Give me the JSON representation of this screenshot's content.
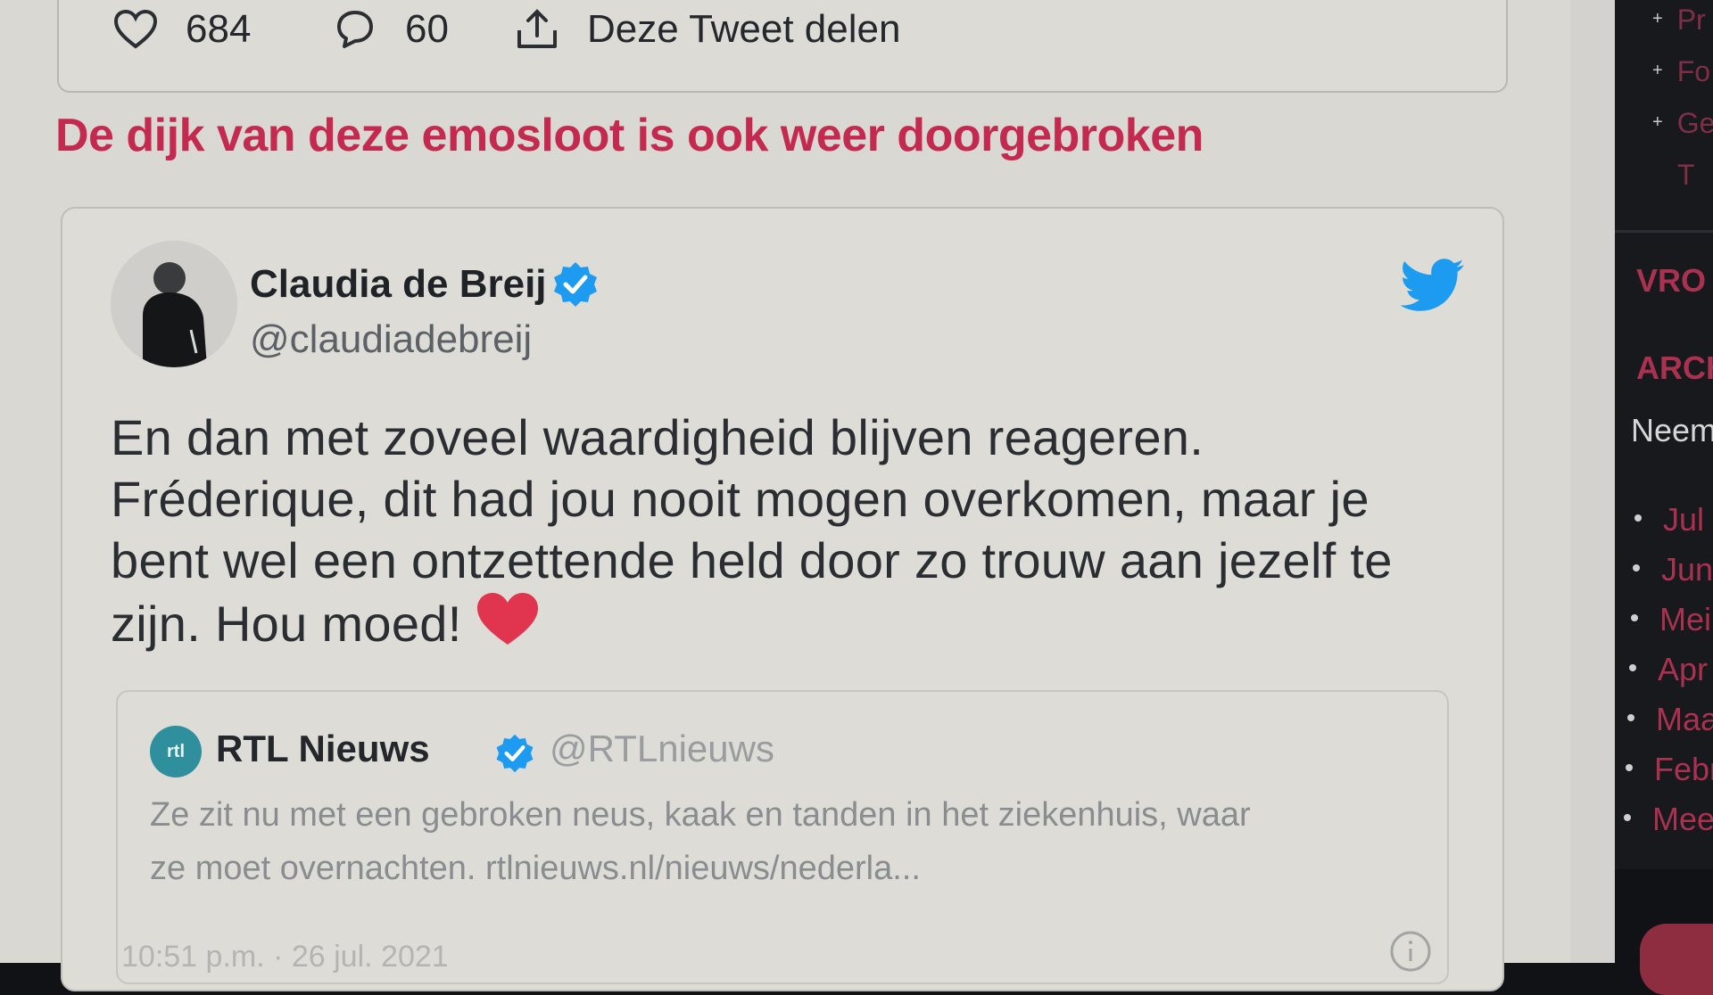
{
  "prev_tweet": {
    "like_count": "684",
    "reply_count": "60",
    "share_label": "Deze Tweet delen"
  },
  "article": {
    "heading": "De dijk van deze emosloot is ook weer doorgebroken"
  },
  "tweet": {
    "author_name": "Claudia de Breij",
    "handle": "@claudiadebreij",
    "lines": [
      "En dan met zoveel waardigheid blijven reageren.",
      "Fréderique, dit had jou nooit mogen overkomen, maar je",
      "bent wel een ontzettende held door zo trouw aan jezelf te",
      "zijn. Hou moed!"
    ],
    "emoji": "red-heart",
    "date": "10:51 p.m. · 26 jul. 2021",
    "quoted": {
      "logo_text": "rtl",
      "name": "RTL Nieuws",
      "handle": "@RTLnieuws",
      "line1": "Ze zit nu met een gebroken neus, kaak en tanden in het ziekenhuis, waar",
      "line2": "ze moet overnachten. rtlnieuws.nl/nieuws/nederla..."
    }
  },
  "sidebar": {
    "top_items": [
      "Pr",
      "Fo",
      "Ge",
      "T"
    ],
    "heading_1": "VRO",
    "heading_2": "ARCH",
    "archive_intro": "Neem",
    "months": [
      "Jul",
      "Jun",
      "Mei",
      "Apr",
      "Maa",
      "Febr",
      "Mee"
    ]
  },
  "colors": {
    "accent": "#c42a50",
    "verified": "#1d9bf0",
    "twitter_bird": "#1d9bf0",
    "sidebar_bg": "#17191d"
  }
}
